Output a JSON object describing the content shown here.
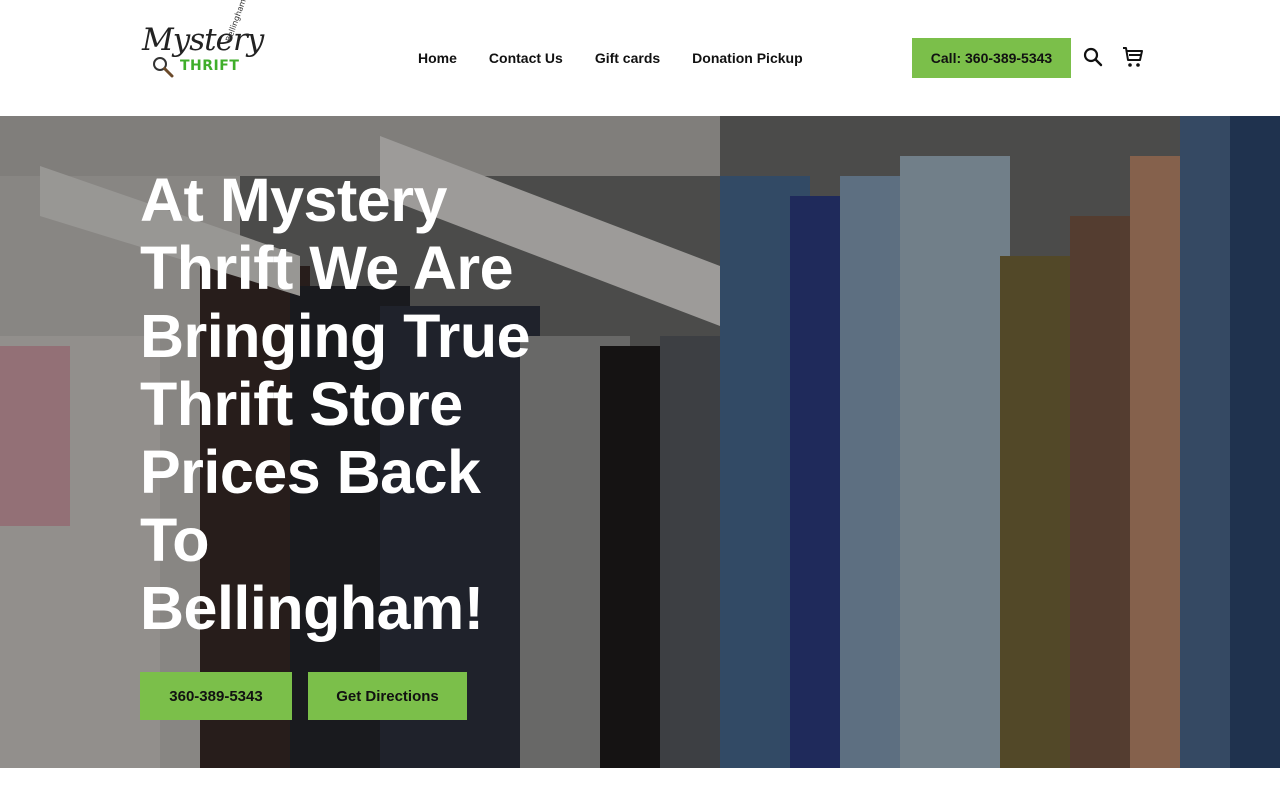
{
  "header": {
    "logo": {
      "script_text": "Mystery",
      "thrift_text": "THRIFT",
      "location_text": "Bellingham",
      "brand_green": "#3fae2a"
    },
    "nav": [
      {
        "label": "Home"
      },
      {
        "label": "Contact Us"
      },
      {
        "label": "Gift cards"
      },
      {
        "label": "Donation Pickup"
      }
    ],
    "call_button_label": "Call: 360-389-5343",
    "icons": [
      "search-icon",
      "cart-icon"
    ]
  },
  "hero": {
    "title": "At Mystery Thrift We Are Bringing True Thrift Store Prices Back To Bellingham!",
    "buttons": [
      {
        "label": "360-389-5343"
      },
      {
        "label": "Get Directions"
      }
    ],
    "accent_color": "#7bbf4a",
    "background_icon": "clothing-rack-photo"
  }
}
